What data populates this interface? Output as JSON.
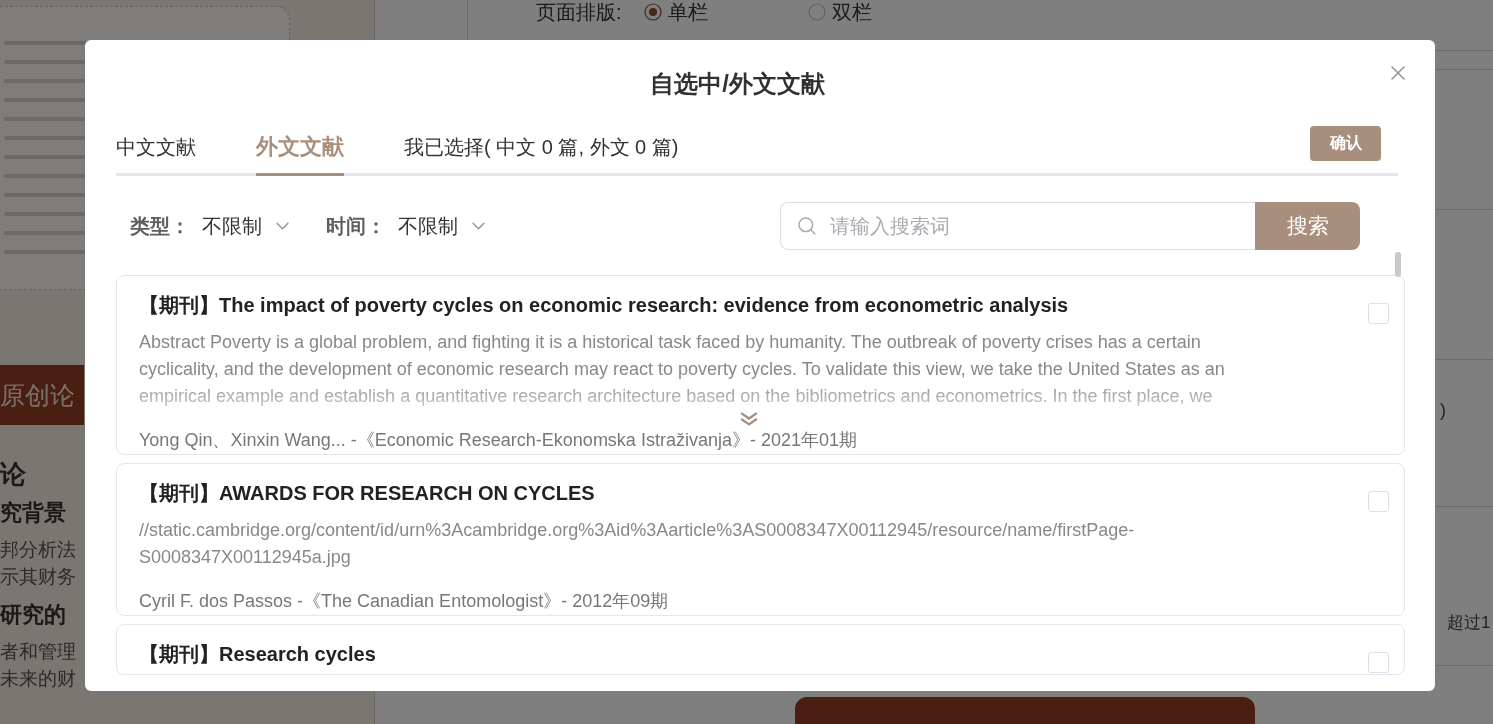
{
  "background_page": {
    "layout_label": "页面排版:",
    "layout_options": [
      {
        "label": "单栏",
        "selected": true
      },
      {
        "label": "双栏",
        "selected": false
      }
    ],
    "document_banner": "原创论",
    "document_lines": [
      {
        "kind": "chapter",
        "text": "论"
      },
      {
        "kind": "section",
        "text": "究背景"
      },
      {
        "kind": "body",
        "text": "邦分析法"
      },
      {
        "kind": "body",
        "text": "示其财务"
      },
      {
        "kind": "section",
        "text": "研究的"
      },
      {
        "kind": "body",
        "text": "者和管理"
      },
      {
        "kind": "body",
        "text": "未来的财"
      }
    ],
    "side_notes": [
      ")",
      "超过1"
    ]
  },
  "dialog": {
    "title": "自选中/外文文献",
    "tabs": [
      {
        "label": "中文文献",
        "selected": false
      },
      {
        "label": "外文文献",
        "selected": true
      },
      {
        "label": "我已选择( 中文 0 篇, 外文 0 篇)",
        "selected": false
      }
    ],
    "confirm_button": "确认",
    "filters": [
      {
        "label": "类型：",
        "value": "不限制"
      },
      {
        "label": "时间：",
        "value": "不限制"
      }
    ],
    "search": {
      "placeholder": "请输入搜索词",
      "button": "搜索"
    },
    "results": [
      {
        "title": "【期刊】The impact of poverty cycles on economic research: evidence from econometric analysis",
        "abstract_lines": [
          "Abstract Poverty is a global problem, and fighting it is a historical task faced by humanity. The outbreak of poverty crises has a certain",
          "cyclicality, and the development of economic research may react to poverty cycles. To validate this view, we take the United States as an",
          "empirical example and establish a quantitative research architecture based on the bibliometrics and econometrics. In the first place, we"
        ],
        "source": "Yong Qin、Xinxin Wang... -《Economic Research-Ekonomska Istraživanja》- 2021年01期",
        "collapsed": true,
        "checked": false
      },
      {
        "title": "【期刊】AWARDS FOR RESEARCH ON CYCLES",
        "abstract_lines": [
          "//static.cambridge.org/content/id/urn%3Acambridge.org%3Aid%3Aarticle%3AS0008347X00112945/resource/name/firstPage-",
          "S0008347X00112945a.jpg"
        ],
        "source": "Cyril F. dos Passos -《The Canadian Entomologist》- 2012年09期",
        "collapsed": false,
        "checked": false
      },
      {
        "title": "【期刊】Research cycles",
        "collapsed": false,
        "checked": false
      }
    ]
  }
}
